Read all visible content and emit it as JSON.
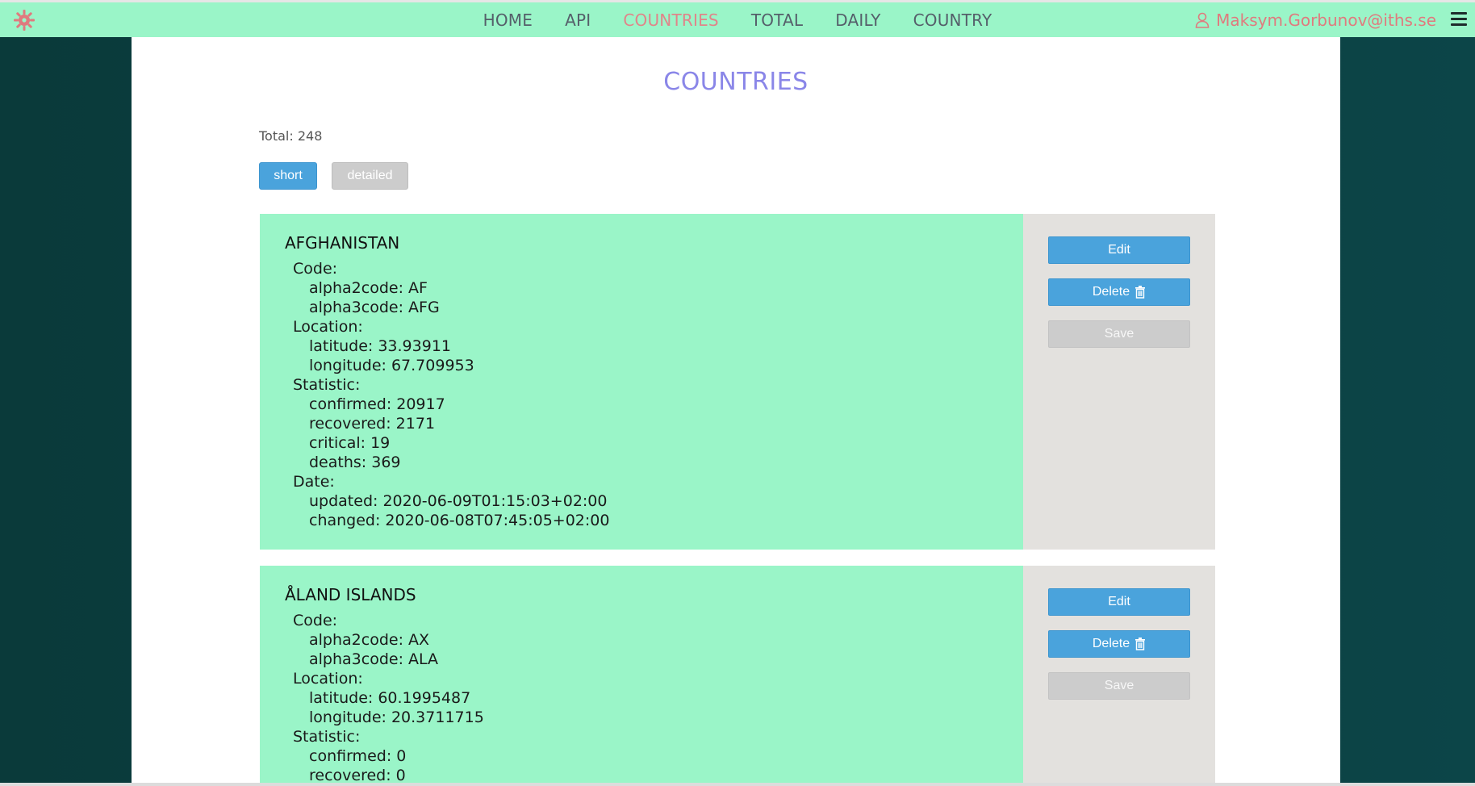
{
  "nav": {
    "links": [
      "HOME",
      "API",
      "COUNTRIES",
      "TOTAL",
      "DAILY",
      "COUNTRY"
    ],
    "active": "COUNTRIES",
    "user_email": "Maksym.Gorbunov@iths.se",
    "logo_icon": "gear-logo-icon",
    "menu_icon": "hamburger-menu-icon"
  },
  "page": {
    "title": "COUNTRIES",
    "total": "Total: 248",
    "view_buttons": {
      "short": "short",
      "detailed": "detailed"
    }
  },
  "actions": {
    "edit": "Edit",
    "delete": "Delete",
    "save": "Save"
  },
  "countries": [
    {
      "name": "AFGHANISTAN",
      "labels": {
        "code": "Code:",
        "location": "Location:",
        "statistic": "Statistic:",
        "date": "Date:"
      },
      "alpha2code": "alpha2code: AF",
      "alpha3code": "alpha3code: AFG",
      "latitude": "latitude: 33.93911",
      "longitude": "longitude: 67.709953",
      "confirmed": "confirmed: 20917",
      "recovered": "recovered: 2171",
      "critical": "critical: 19",
      "deaths": "deaths: 369",
      "updated": "updated: 2020-06-09T01:15:03+02:00",
      "changed": "changed: 2020-06-08T07:45:05+02:00"
    },
    {
      "name": "ÅLAND ISLANDS",
      "labels": {
        "code": "Code:",
        "location": "Location:",
        "statistic": "Statistic:"
      },
      "alpha2code": "alpha2code: AX",
      "alpha3code": "alpha3code: ALA",
      "latitude": "latitude: 60.1995487",
      "longitude": "longitude: 20.3711715",
      "confirmed": "confirmed: 0",
      "recovered": "recovered: 0"
    }
  ],
  "colors": {
    "navbar": "#9af5c8",
    "active_link": "#e0858a",
    "title": "#8a86e8",
    "primary_button": "#4aa3dc",
    "disabled_button": "#cccccc",
    "card_info": "#9af5c8",
    "card_actions": "#e3e1de"
  }
}
